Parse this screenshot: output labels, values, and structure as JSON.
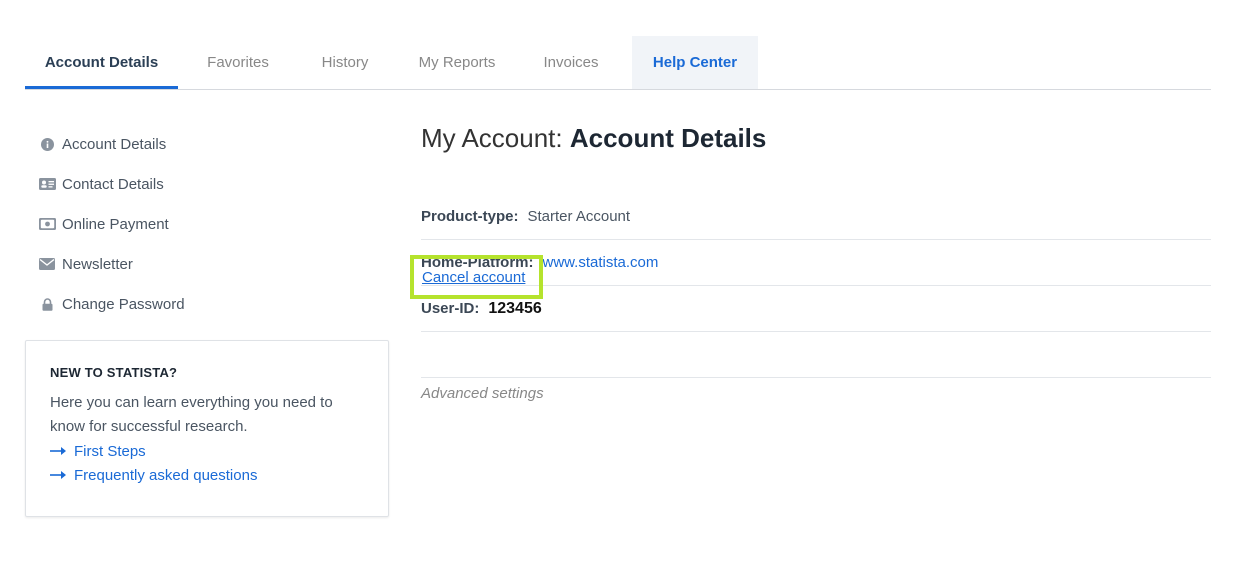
{
  "tabs": [
    {
      "label": "Account Details"
    },
    {
      "label": "Favorites"
    },
    {
      "label": "History"
    },
    {
      "label": "My Reports"
    },
    {
      "label": "Invoices"
    },
    {
      "label": "Help Center"
    }
  ],
  "sidebar": {
    "items": [
      {
        "label": "Account Details",
        "icon": "info-icon"
      },
      {
        "label": "Contact Details",
        "icon": "contact-card-icon"
      },
      {
        "label": "Online Payment",
        "icon": "money-icon"
      },
      {
        "label": "Newsletter",
        "icon": "envelope-icon"
      },
      {
        "label": "Change Password",
        "icon": "lock-icon"
      }
    ]
  },
  "promo": {
    "title": "NEW TO STATISTA?",
    "text": "Here you can learn everything you need to know for successful research.",
    "links": [
      {
        "label": "First Steps"
      },
      {
        "label": "Frequently asked questions"
      }
    ]
  },
  "main": {
    "title_prefix": "My Account:",
    "title_strong": "Account Details",
    "product_type_label": "Product-type:",
    "product_type_value": "Starter Account",
    "home_platform_label": "Home-Platform:",
    "home_platform_value": "www.statista.com",
    "user_id_label": "User-ID:",
    "user_id_value": "123456",
    "cancel_label": "Cancel account",
    "advanced_label": "Advanced settings"
  },
  "colors": {
    "accent": "#1a6ad6",
    "highlight": "#b5e32d",
    "help_tab_bg": "#f1f4f8"
  }
}
